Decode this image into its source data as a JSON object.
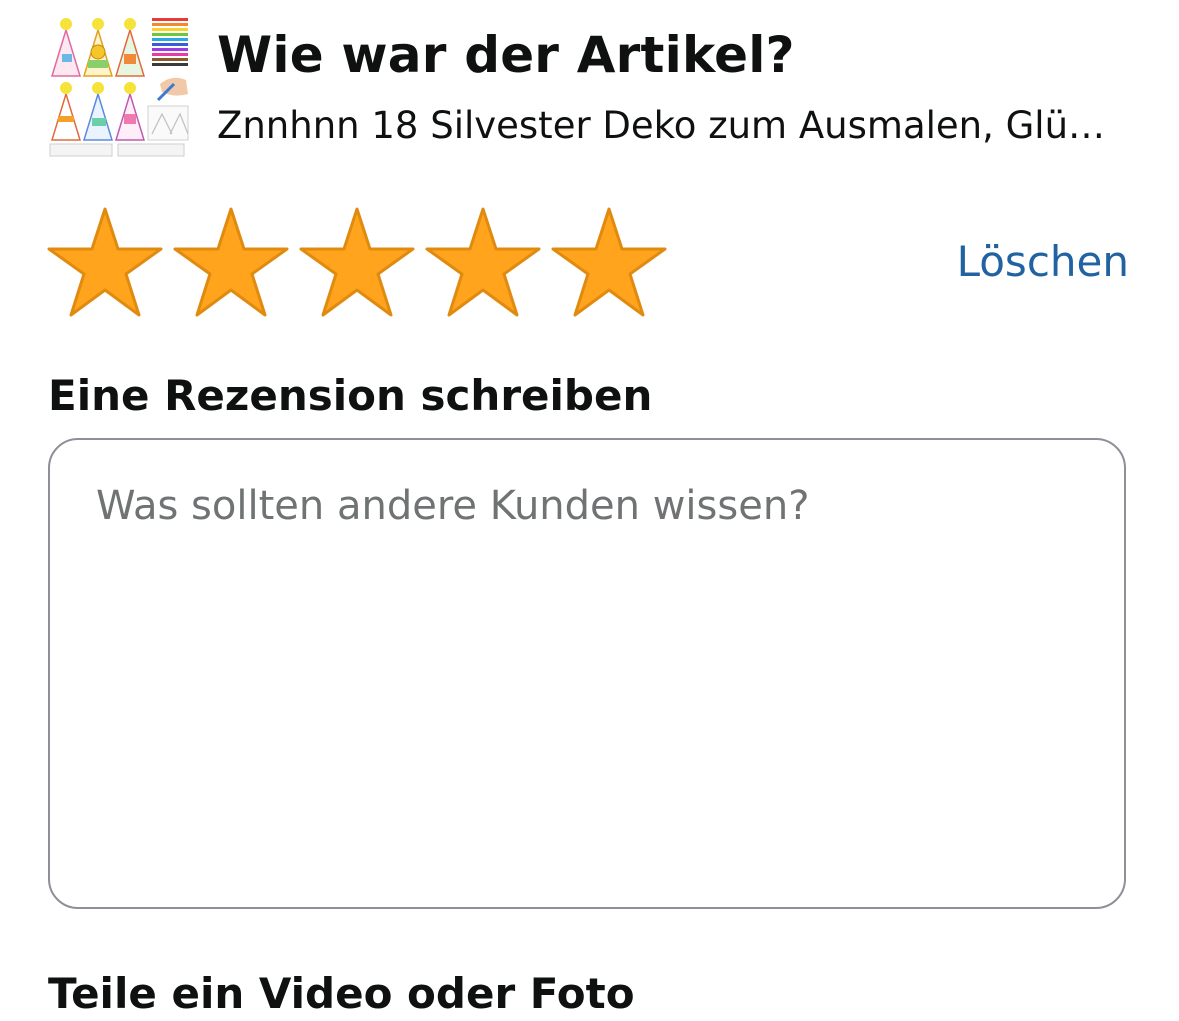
{
  "header": {
    "title": "Wie war der Artikel?",
    "product_name": "Znnhnn 18 Silvester Deko zum Ausmalen, Glü…"
  },
  "product_image": {
    "icon": "party-hats-coloring-image"
  },
  "rating": {
    "max_stars": 5,
    "selected_stars": 5,
    "star_color": "#ffa41c",
    "star_outline_color": "#e08b10",
    "clear_label": "Löschen",
    "link_color": "#2162a1"
  },
  "review": {
    "heading": "Eine Rezension schreiben",
    "placeholder": "Was sollten andere Kunden wissen?",
    "value": ""
  },
  "media": {
    "heading": "Teile ein Video oder Foto"
  }
}
